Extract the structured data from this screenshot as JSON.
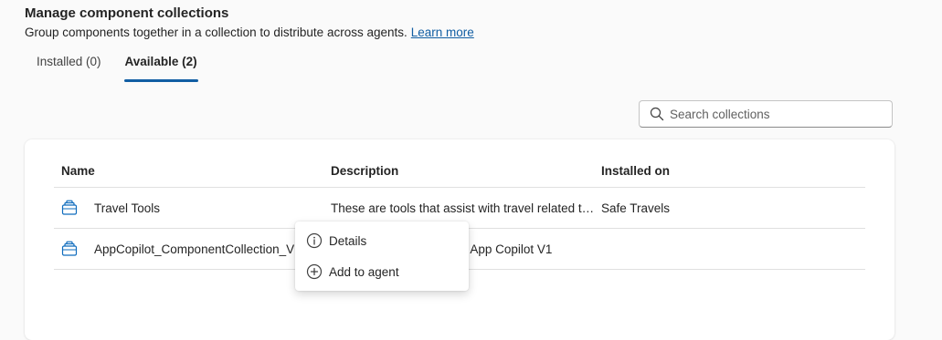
{
  "header": {
    "title": "Manage component collections",
    "subtitle": "Group components together in a collection to distribute across agents.",
    "learn_more": "Learn more"
  },
  "tabs": [
    {
      "label": "Installed (0)",
      "active": false
    },
    {
      "label": "Available (2)",
      "active": true
    }
  ],
  "search": {
    "placeholder": "Search collections",
    "value": ""
  },
  "table": {
    "columns": [
      "Name",
      "Description",
      "Installed on"
    ],
    "rows": [
      {
        "name": "Travel Tools",
        "description": "These are tools that assist with travel related tasks",
        "installed_on": "Safe Travels",
        "icon": "collection-icon"
      },
      {
        "name": "AppCopilot_ComponentCollection_V1",
        "description": "Component collection for App Copilot V1",
        "installed_on": "",
        "icon": "collection-icon"
      }
    ]
  },
  "context_menu": {
    "items": [
      {
        "label": "Details",
        "icon": "info-icon"
      },
      {
        "label": "Add to agent",
        "icon": "add-circle-icon"
      }
    ]
  },
  "colors": {
    "accent": "#115ea3",
    "background": "#fafafa",
    "card": "#ffffff",
    "divider": "#e0e0e0"
  }
}
